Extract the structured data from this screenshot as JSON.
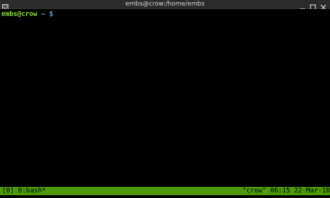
{
  "window": {
    "title": "embs@crow:/home/embs"
  },
  "terminal": {
    "user_host": "embs@crow",
    "cwd": "~",
    "prompt_symbol": "$"
  },
  "tmux": {
    "session": "[0]",
    "window_label": "0:bash*",
    "host": "\"crow\"",
    "time": "06:15",
    "date": "22-Mar-18"
  },
  "colors": {
    "status_bg": "#4e9a06",
    "prompt_user": "#8ae234",
    "prompt_dir": "#729fcf",
    "title_bg": "#2b2b2b"
  },
  "icons": {
    "app": "terminal-icon",
    "minimize": "minimize-icon",
    "maximize": "maximize-icon",
    "close": "close-icon"
  }
}
